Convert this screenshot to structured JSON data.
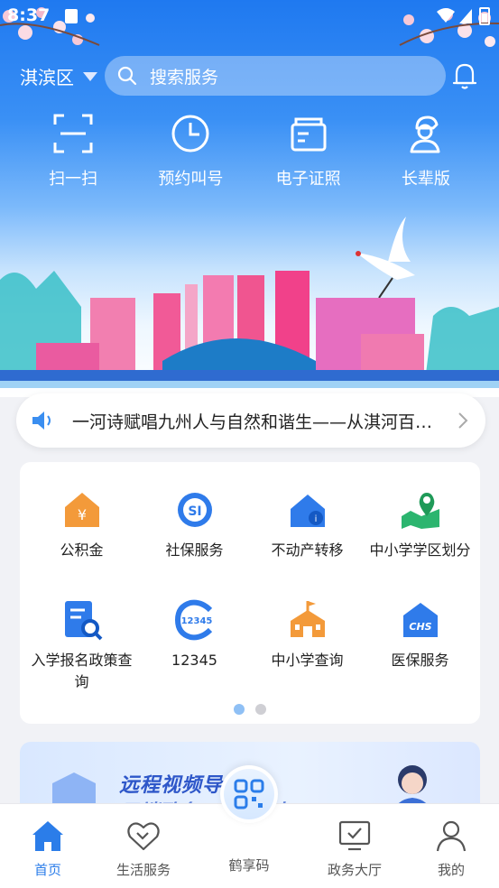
{
  "status_bar": {
    "time": "8:37"
  },
  "header": {
    "region": "淇滨区",
    "search_placeholder": "搜索服务"
  },
  "quick_actions": [
    {
      "label": "扫一扫",
      "icon": "scan-icon"
    },
    {
      "label": "预约叫号",
      "icon": "clock-icon"
    },
    {
      "label": "电子证照",
      "icon": "certificate-icon"
    },
    {
      "label": "长辈版",
      "icon": "elder-icon"
    }
  ],
  "notice": {
    "text": "一河诗赋唱九州人与自然和谐生——从淇河百…"
  },
  "services": [
    {
      "label": "公积金",
      "icon": "housing-fund-icon"
    },
    {
      "label": "社保服务",
      "icon": "social-security-icon"
    },
    {
      "label": "不动产转移",
      "icon": "real-estate-icon"
    },
    {
      "label": "中小学学区划分",
      "icon": "map-pin-icon"
    },
    {
      "label": "入学报名政策查询",
      "icon": "doc-search-icon"
    },
    {
      "label": "12345",
      "icon": "hotline-12345-icon"
    },
    {
      "label": "中小学查询",
      "icon": "school-icon"
    },
    {
      "label": "医保服务",
      "icon": "medical-insurance-icon"
    }
  ],
  "pager": {
    "pages": 2,
    "active": 1
  },
  "banner": {
    "line1": "远程视频导办",
    "line2": "云端政务 …… 即办!"
  },
  "tabbar": {
    "items": [
      {
        "label": "首页",
        "icon": "home-icon",
        "active": true
      },
      {
        "label": "生活服务",
        "icon": "handshake-icon",
        "active": false
      },
      {
        "label": "鹤享码",
        "icon": "qr-code-icon",
        "active": false
      },
      {
        "label": "政务大厅",
        "icon": "monitor-check-icon",
        "active": false
      },
      {
        "label": "我的",
        "icon": "user-icon",
        "active": false
      }
    ]
  },
  "colors": {
    "accent": "#2b7de9",
    "orange": "#f39a3a",
    "blue": "#2f7bea",
    "green": "#2cb56f"
  }
}
